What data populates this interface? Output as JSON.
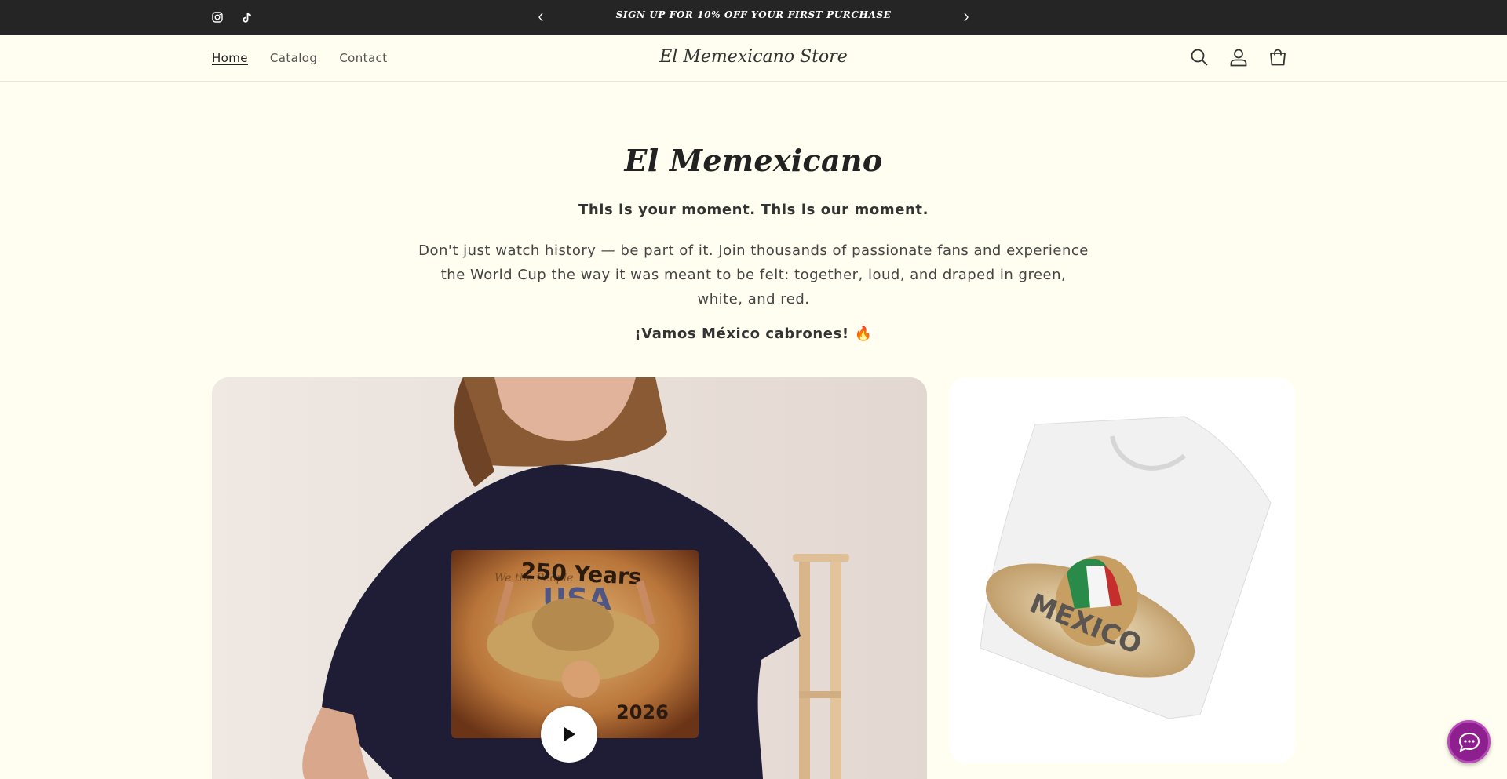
{
  "announcement": {
    "message": "SIGN UP FOR 10% OFF YOUR FIRST PURCHASE"
  },
  "social": [
    "instagram-icon",
    "tiktok-icon"
  ],
  "header": {
    "nav": [
      {
        "label": "Home",
        "active": true
      },
      {
        "label": "Catalog",
        "active": false
      },
      {
        "label": "Contact",
        "active": false
      }
    ],
    "brand": "El Memexicano Store",
    "icons": [
      "search-icon",
      "account-icon",
      "cart-icon"
    ]
  },
  "hero": {
    "title": "El Memexicano",
    "subtitle": "This is your moment. This is our moment.",
    "description": "Don't just watch history — be part of it. Join thousands of passionate fans and experience the World Cup the way it was meant to be felt: together, loud, and draped in green, white, and red.",
    "cta": "¡Vamos México cabrones! 🔥"
  },
  "media": {
    "shirt_print_title": "250 Years",
    "shirt_print_usa": "USA",
    "shirt_print_year": "2026",
    "shirt_print_script": "We the People"
  },
  "product_card": {
    "sombrero_text": "MEXICO"
  },
  "colors": {
    "announcement_bg": "#252525",
    "page_bg": "#fffef0",
    "chat_button": "#8e1f8f",
    "shirt_navy": "#1e1d35"
  }
}
